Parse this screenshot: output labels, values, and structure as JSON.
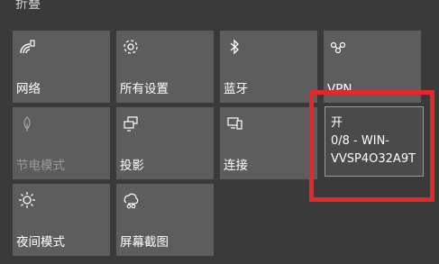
{
  "panel": {
    "header": "折叠"
  },
  "tiles": [
    {
      "label": "网络",
      "icon": "network-wifi-icon"
    },
    {
      "label": "所有设置",
      "icon": "gear-icon"
    },
    {
      "label": "蓝牙",
      "icon": "bluetooth-icon"
    },
    {
      "label": "VPN",
      "icon": "vpn-icon"
    },
    {
      "label": "节电模式",
      "icon": "battery-saver-icon"
    },
    {
      "label": "投影",
      "icon": "project-icon"
    },
    {
      "label": "连接",
      "icon": "connect-icon"
    },
    {
      "label": "夜间模式",
      "icon": "night-light-icon"
    },
    {
      "label": "屏幕截图",
      "icon": "screen-snip-icon"
    }
  ],
  "hotspot_popup": {
    "state": "开",
    "clients": "0/8 - WIN-",
    "device": "VVSP4O32A9T"
  },
  "colors": {
    "background": "#3a3a3a",
    "tile": "#5d5d5d",
    "highlight": "#e6262b"
  }
}
